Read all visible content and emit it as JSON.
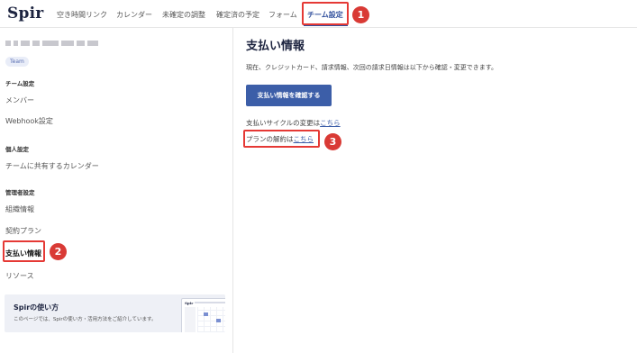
{
  "app": {
    "logo": "Spir"
  },
  "topnav": {
    "items": [
      {
        "label": "空き時間リンク"
      },
      {
        "label": "カレンダー"
      },
      {
        "label": "未確定の調整"
      },
      {
        "label": "確定済の予定"
      },
      {
        "label": "フォーム"
      },
      {
        "label": "チーム設定"
      }
    ],
    "active_index": 5
  },
  "sidebar": {
    "team_badge": "Team",
    "sections": [
      {
        "title": "チーム設定",
        "items": [
          {
            "label": "メンバー"
          },
          {
            "label": "Webhook設定"
          }
        ]
      },
      {
        "title": "個人設定",
        "items": [
          {
            "label": "チームに共有するカレンダー"
          }
        ]
      },
      {
        "title": "管理者設定",
        "items": [
          {
            "label": "組織情報"
          },
          {
            "label": "契約プラン"
          },
          {
            "label": "支払い情報"
          },
          {
            "label": "リソース"
          }
        ]
      }
    ],
    "active_item": "支払い情報",
    "promo": {
      "title": "Spirの使い方",
      "description": "このページでは、Spirの使い方・活用方法をご紹介しています。",
      "thumb_logo": "Spir"
    }
  },
  "main": {
    "title": "支払い情報",
    "description": "現在、クレジットカード、請求情報、次回の請求日情報は以下から確認・変更できます。",
    "confirm_button": "支払い情報を確認する",
    "cycle_text": "支払いサイクルの変更は",
    "cycle_link": "こちら",
    "cancel_text": "プランの解約は",
    "cancel_link": "こちら"
  },
  "annotations": {
    "colors": {
      "box": "#e53935",
      "badge": "#d93a35"
    },
    "badges": [
      "1",
      "2",
      "3"
    ]
  },
  "colors": {
    "accent": "#3c5ea8",
    "brand_dark": "#1d2440",
    "active_nav": "#2f4e9c"
  }
}
